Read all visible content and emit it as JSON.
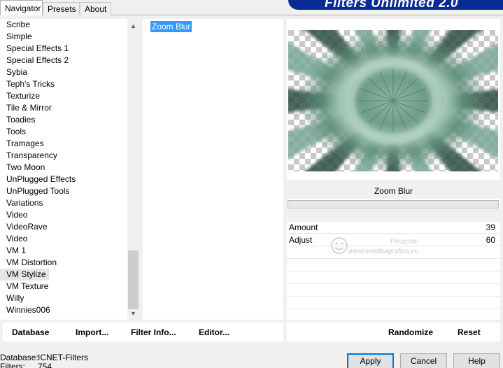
{
  "tabs": [
    "Navigator",
    "Presets",
    "About"
  ],
  "banner_title": "Filters Unlimited 2.0",
  "categories": [
    "Scribe",
    "Simple",
    "Special Effects 1",
    "Special Effects 2",
    "Sybia",
    "Teph's Tricks",
    "Texturize",
    "Tile & Mirror",
    "Toadies",
    "Tools",
    "Tramages",
    "Transparency",
    "Two Moon",
    "UnPlugged Effects",
    "UnPlugged Tools",
    "Variations",
    "Video",
    "VideoRave",
    "Video",
    "VM 1",
    "VM Distortion",
    "VM Stylize",
    "VM Texture",
    "Willy",
    "Winnies006"
  ],
  "selected_category": "VM Stylize",
  "selected_filter": "Zoom Blur",
  "filter_name": "Zoom Blur",
  "params": [
    {
      "name": "Amount",
      "value": "39"
    },
    {
      "name": "Adjust",
      "value": "60"
    }
  ],
  "watermark": {
    "line1": "Pinuccia",
    "line2": "www.maldiragrafica.eu"
  },
  "left_buttons": [
    "Database",
    "Import...",
    "Filter Info...",
    "Editor..."
  ],
  "right_buttons": [
    "Randomize",
    "Reset"
  ],
  "info": {
    "database_label": "Database:",
    "database_value": "ICNET-Filters",
    "filters_label": "Filters:",
    "filters_value": "754"
  },
  "dialog_buttons": {
    "apply": "Apply",
    "cancel": "Cancel",
    "help": "Help"
  },
  "colors": {
    "selection": "#3399ff",
    "banner": "#0a2a96",
    "preview_tint": "#6e9c88"
  }
}
